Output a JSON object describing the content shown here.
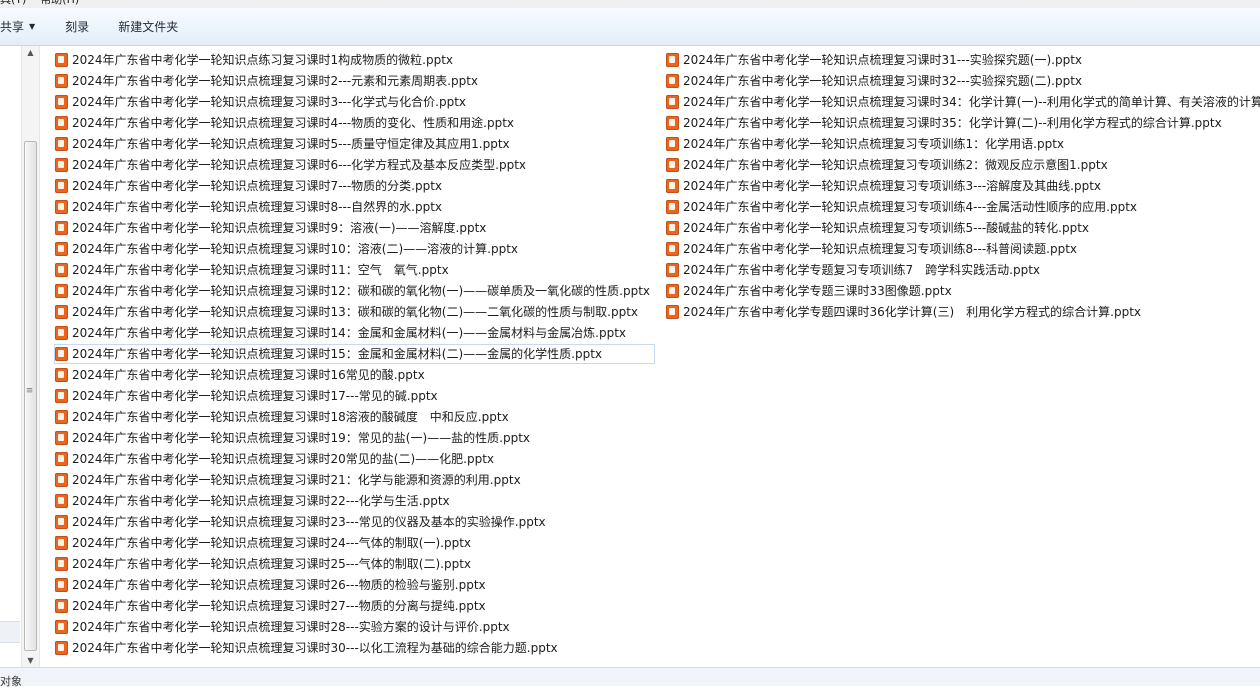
{
  "menu": {
    "items": [
      "具(T)",
      "帮助(H)"
    ]
  },
  "toolbar": {
    "share_label": "共享",
    "burn_label": "刻录",
    "new_folder_label": "新建文件夹"
  },
  "files": {
    "column1": [
      "2024年广东省中考化学一轮知识点练习复习课时1构成物质的微粒.pptx",
      "2024年广东省中考化学一轮知识点梳理复习课时2---元素和元素周期表.pptx",
      "2024年广东省中考化学一轮知识点梳理复习课时3---化学式与化合价.pptx",
      "2024年广东省中考化学一轮知识点梳理复习课时4---物质的变化、性质和用途.pptx",
      "2024年广东省中考化学一轮知识点梳理复习课时5---质量守恒定律及其应用1.pptx",
      "2024年广东省中考化学一轮知识点梳理复习课时6---化学方程式及基本反应类型.pptx",
      "2024年广东省中考化学一轮知识点梳理复习课时7---物质的分类.pptx",
      "2024年广东省中考化学一轮知识点梳理复习课时8---自然界的水.pptx",
      "2024年广东省中考化学一轮知识点梳理复习课时9：溶液(一)——溶解度.pptx",
      "2024年广东省中考化学一轮知识点梳理复习课时10：溶液(二)——溶液的计算.pptx",
      "2024年广东省中考化学一轮知识点梳理复习课时11：空气　氧气.pptx",
      "2024年广东省中考化学一轮知识点梳理复习课时12：碳和碳的氧化物(一)——碳单质及一氧化碳的性质.pptx",
      "2024年广东省中考化学一轮知识点梳理复习课时13：碳和碳的氧化物(二)——二氧化碳的性质与制取.pptx",
      "2024年广东省中考化学一轮知识点梳理复习课时14：金属和金属材料(一)——金属材料与金属冶炼.pptx",
      "2024年广东省中考化学一轮知识点梳理复习课时15：金属和金属材料(二)——金属的化学性质.pptx",
      "2024年广东省中考化学一轮知识点梳理复习课时16常见的酸.pptx",
      "2024年广东省中考化学一轮知识点梳理复习课时17---常见的碱.pptx",
      "2024年广东省中考化学一轮知识点梳理复习课时18溶液的酸碱度　中和反应.pptx",
      "2024年广东省中考化学一轮知识点梳理复习课时19：常见的盐(一)——盐的性质.pptx",
      "2024年广东省中考化学一轮知识点梳理复习课时20常见的盐(二)——化肥.pptx",
      "2024年广东省中考化学一轮知识点梳理复习课时21：化学与能源和资源的利用.pptx",
      "2024年广东省中考化学一轮知识点梳理复习课时22---化学与生活.pptx",
      "2024年广东省中考化学一轮知识点梳理复习课时23---常见的仪器及基本的实验操作.pptx",
      "2024年广东省中考化学一轮知识点梳理复习课时24---气体的制取(一).pptx",
      "2024年广东省中考化学一轮知识点梳理复习课时25---气体的制取(二).pptx",
      "2024年广东省中考化学一轮知识点梳理复习课时26---物质的检验与鉴别.pptx",
      "2024年广东省中考化学一轮知识点梳理复习课时27---物质的分离与提纯.pptx",
      "2024年广东省中考化学一轮知识点梳理复习课时28---实验方案的设计与评价.pptx",
      "2024年广东省中考化学一轮知识点梳理复习课时30---以化工流程为基础的综合能力题.pptx"
    ],
    "column2": [
      "2024年广东省中考化学一轮知识点梳理复习课时31---实验探究题(一).pptx",
      "2024年广东省中考化学一轮知识点梳理复习课时32---实验探究题(二).pptx",
      "2024年广东省中考化学一轮知识点梳理复习课时34：化学计算(一)--利用化学式的简单计算、有关溶液的计算",
      "2024年广东省中考化学一轮知识点梳理复习课时35：化学计算(二)--利用化学方程式的综合计算.pptx",
      "2024年广东省中考化学一轮知识点梳理复习专项训练1：化学用语.pptx",
      "2024年广东省中考化学一轮知识点梳理复习专项训练2：微观反应示意图1.pptx",
      "2024年广东省中考化学一轮知识点梳理复习专项训练3---溶解度及其曲线.pptx",
      "2024年广东省中考化学一轮知识点梳理复习专项训练4---金属活动性顺序的应用.pptx",
      "2024年广东省中考化学一轮知识点梳理复习专项训练5---酸碱盐的转化.pptx",
      "2024年广东省中考化学一轮知识点梳理复习专项训练8---科普阅读题.pptx",
      "2024年广东省中考化学专题复习专项训练7　跨学科实践活动.pptx",
      "2024年广东省中考化学专题三课时33图像题.pptx",
      "2024年广东省中考化学专题四课时36化学计算(三)　利用化学方程式的综合计算.pptx"
    ]
  },
  "status": {
    "text": "对象"
  },
  "colors": {
    "pptx_icon": "#e8661f",
    "toolbar_top": "#f7fbff",
    "toolbar_bottom": "#e4eef8"
  }
}
